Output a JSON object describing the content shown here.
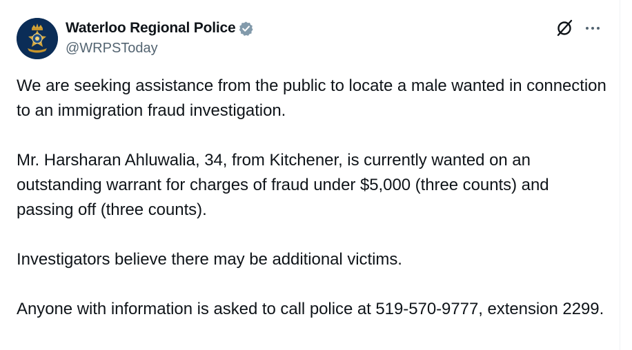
{
  "account": {
    "display_name": "Waterloo Regional Police",
    "handle": "@WRPSToday",
    "verified_icon": "verified-badge-gray",
    "avatar_icon": "police-crest-logo"
  },
  "actions": {
    "grok_icon": "grok-slash-icon",
    "more_icon": "more-horizontal-icon"
  },
  "tweet": {
    "paragraphs": [
      "We are seeking assistance from the public to locate a male wanted in connection to an immigration fraud investigation.",
      "Mr. Harsharan Ahluwalia, 34, from Kitchener, is currently wanted on an outstanding warrant for charges of fraud under $5,000 (three counts) and passing off (three counts).",
      "Investigators believe there may be additional victims.",
      "Anyone with information is asked to call police at 519-570-9777, extension 2299."
    ]
  },
  "colors": {
    "text": "#0f1419",
    "secondary_text": "#536471",
    "verified_badge": "#829aab",
    "avatar_bg": "#0b2d57",
    "crest_gold": "#d4a53a"
  }
}
